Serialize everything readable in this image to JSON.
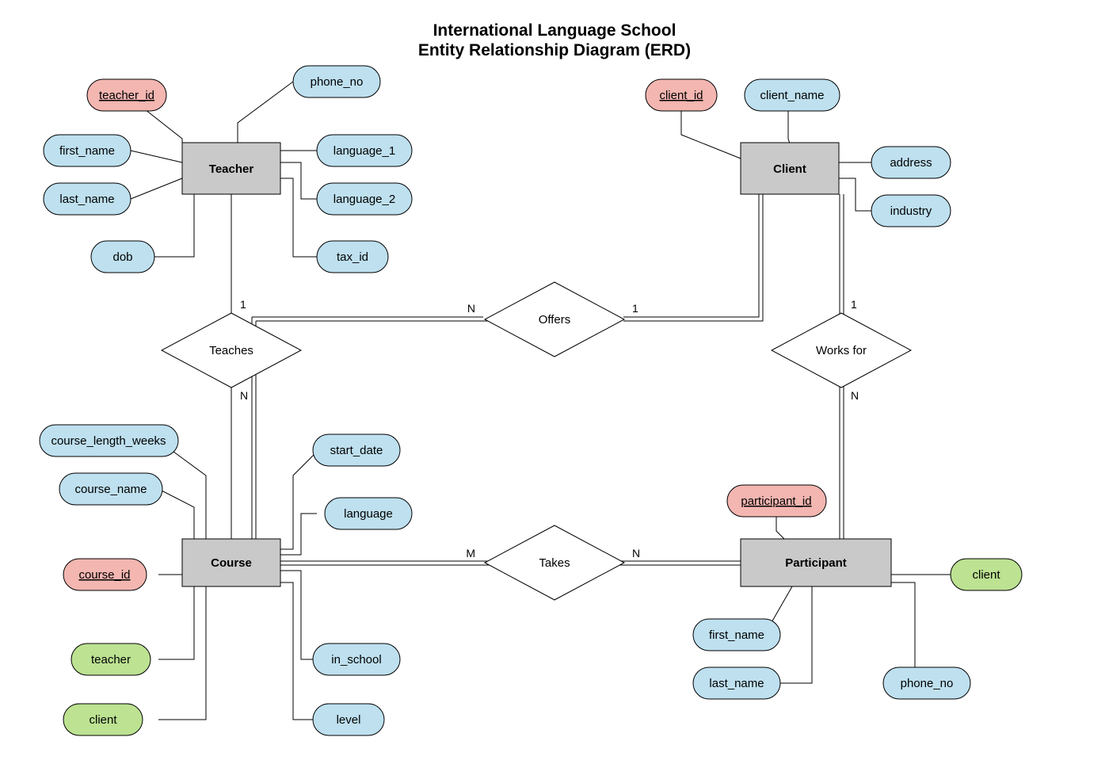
{
  "title": {
    "line1": "International Language School",
    "line2": "Entity Relationship Diagram (ERD)"
  },
  "entities": {
    "teacher": {
      "label": "Teacher"
    },
    "client": {
      "label": "Client"
    },
    "course": {
      "label": "Course"
    },
    "participant": {
      "label": "Participant"
    }
  },
  "relationships": {
    "teaches": {
      "label": "Teaches",
      "card_top": "1",
      "card_bottom": "N"
    },
    "offers": {
      "label": "Offers",
      "card_left": "N",
      "card_right": "1"
    },
    "worksfor": {
      "label": "Works for",
      "card_top": "1",
      "card_bottom": "N"
    },
    "takes": {
      "label": "Takes",
      "card_left": "M",
      "card_right": "N"
    }
  },
  "attributes": {
    "teacher": {
      "teacher_id": "teacher_id",
      "first_name": "first_name",
      "last_name": "last_name",
      "dob": "dob",
      "phone_no": "phone_no",
      "language_1": "language_1",
      "language_2": "language_2",
      "tax_id": "tax_id"
    },
    "client": {
      "client_id": "client_id",
      "client_name": "client_name",
      "address": "address",
      "industry": "industry"
    },
    "course": {
      "course_length_weeks": "course_length_weeks",
      "course_name": "course_name",
      "course_id": "course_id",
      "teacher": "teacher",
      "client": "client",
      "start_date": "start_date",
      "language": "language",
      "in_school": "in_school",
      "level": "level"
    },
    "participant": {
      "participant_id": "participant_id",
      "first_name": "first_name",
      "last_name": "last_name",
      "phone_no": "phone_no",
      "client": "client"
    }
  }
}
